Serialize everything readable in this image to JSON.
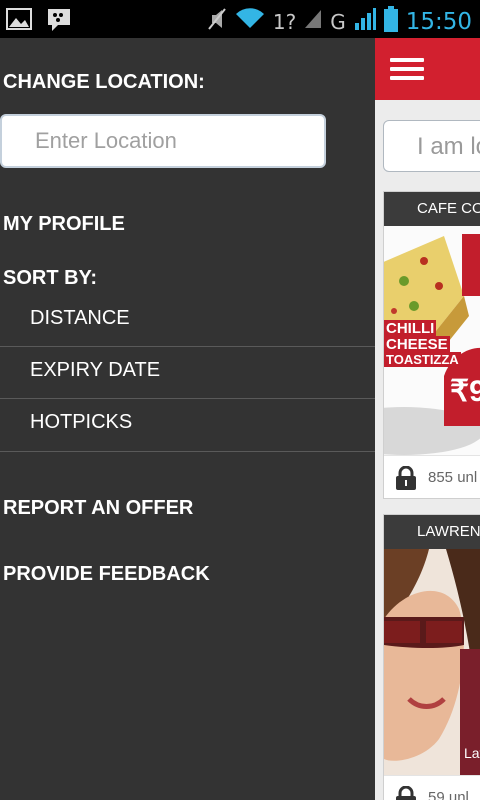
{
  "status_bar": {
    "time": "15:50",
    "network": "G",
    "sim_indicator": "1?"
  },
  "drawer": {
    "change_location_label": "CHANGE LOCATION:",
    "location_placeholder": "Enter Location",
    "my_profile_label": "MY PROFILE",
    "sort_by_label": "SORT BY:",
    "sort_options": [
      "DISTANCE",
      "EXPIRY DATE",
      "HOTPICKS"
    ],
    "report_offer_label": "REPORT AN OFFER",
    "feedback_label": "PROVIDE FEEDBACK"
  },
  "content": {
    "search_placeholder": "I am lo",
    "cards": [
      {
        "title": "CAFE CO",
        "unlocks": "855 unl",
        "promo_line1": "CHILLI",
        "promo_line2": "CHEESE",
        "promo_line3": "TOASTIZZA",
        "price": "₹9"
      },
      {
        "title": "LAWRENC",
        "unlocks": "59 unl"
      }
    ]
  },
  "colors": {
    "drawer_bg": "#333333",
    "appbar_red": "#d2202f",
    "status_time": "#33b5e5"
  }
}
